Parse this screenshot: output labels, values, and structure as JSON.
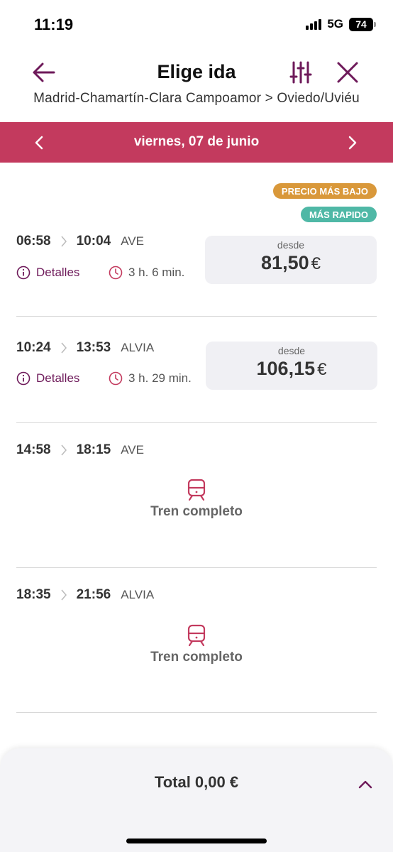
{
  "status_bar": {
    "time": "11:19",
    "network": "5G",
    "battery": "74"
  },
  "header": {
    "title": "Elige ida",
    "route": "Madrid-Chamartín-Clara Campoamor > Oviedo/Uviéu"
  },
  "date_bar": {
    "date": "viernes, 07 de junio"
  },
  "badges": {
    "cheapest": "PRECIO MÁS BAJO",
    "fastest": "MÁS RAPIDO"
  },
  "trips": [
    {
      "departure": "06:58",
      "arrival": "10:04",
      "type": "AVE",
      "details_label": "Detalles",
      "duration": "3 h. 6 min.",
      "price_from": "desde",
      "price": "81,50",
      "currency": "€"
    },
    {
      "departure": "10:24",
      "arrival": "13:53",
      "type": "ALVIA",
      "details_label": "Detalles",
      "duration": "3 h. 29 min.",
      "price_from": "desde",
      "price": "106,15",
      "currency": "€"
    },
    {
      "departure": "14:58",
      "arrival": "18:15",
      "type": "AVE",
      "status": "Tren completo"
    },
    {
      "departure": "18:35",
      "arrival": "21:56",
      "type": "ALVIA",
      "status": "Tren completo"
    }
  ],
  "footer": {
    "total": "Total 0,00 €"
  },
  "colors": {
    "accent": "#c33a5e",
    "brand": "#6e1a5a",
    "cheapest_badge": "#d9983a",
    "fastest_badge": "#4fb8a6"
  },
  "icons": {
    "back": "arrow-left-icon",
    "filter": "sliders-icon",
    "close": "close-icon",
    "prev": "chevron-left-icon",
    "next": "chevron-right-icon",
    "info": "info-icon",
    "clock": "clock-icon",
    "train": "train-icon",
    "expand": "chevron-up-icon"
  }
}
